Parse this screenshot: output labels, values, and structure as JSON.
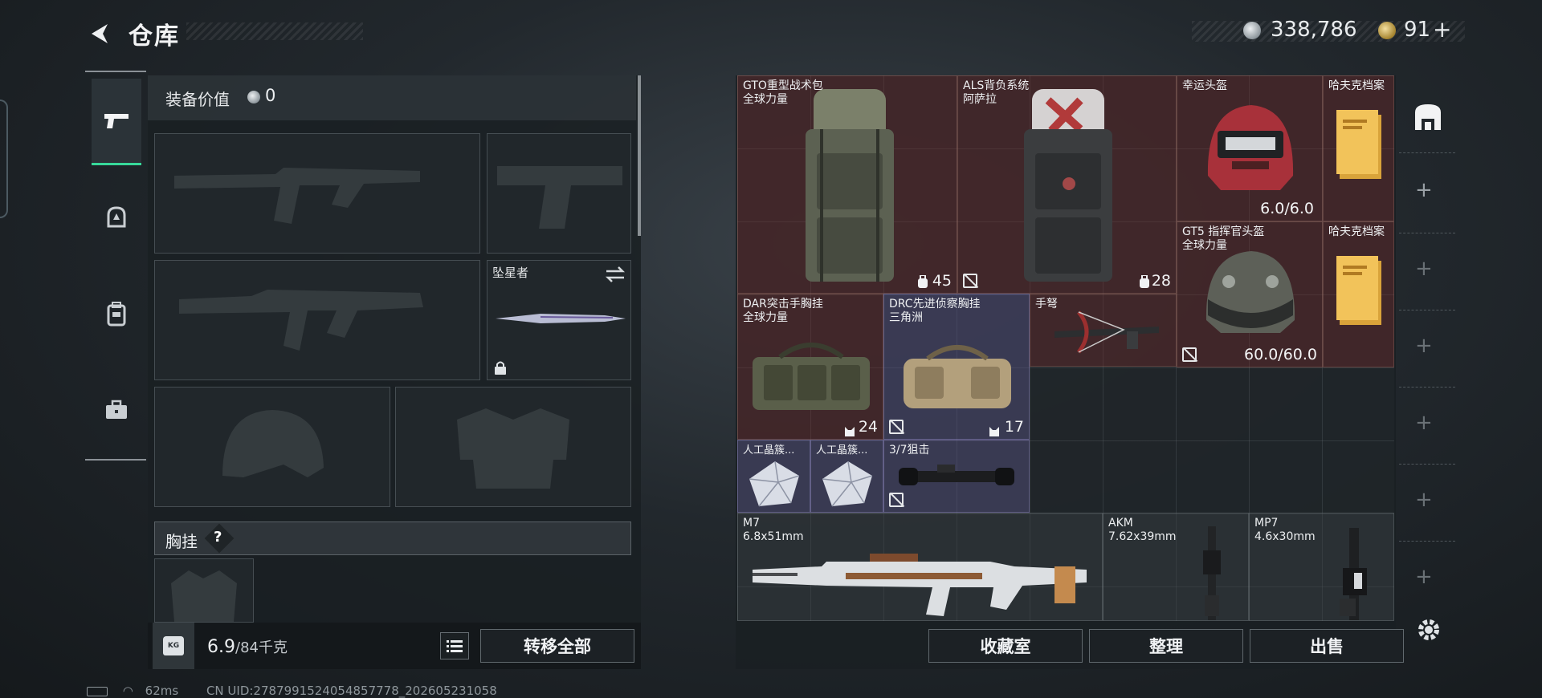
{
  "header": {
    "title": "仓库",
    "currency_silver": "338,786",
    "currency_gold": "91",
    "currency_gold_plus": "+"
  },
  "equipment": {
    "value_label": "装备价值",
    "value": "0",
    "melee_name": "坠星者",
    "chest_label": "胸挂",
    "chest_help": "?"
  },
  "weight": {
    "icon_text": "KG",
    "current": "6.9",
    "max": "/84千克"
  },
  "buttons": {
    "transfer_all": "转移全部",
    "collection_room": "收藏室",
    "sort": "整理",
    "sell": "出售"
  },
  "inventory": {
    "items": [
      {
        "name": "GTO重型战术包",
        "sub": "全球力量",
        "count": "45"
      },
      {
        "name": "ALS背负系统",
        "sub": "阿萨拉",
        "count": "28"
      },
      {
        "name": "幸运头盔",
        "durability": "6.0/6.0"
      },
      {
        "name": "哈夫克档案"
      },
      {
        "name": "GT5 指挥官头盔",
        "sub": "全球力量",
        "durability": "60.0/60.0"
      },
      {
        "name": "哈夫克档案"
      },
      {
        "name": "DAR突击手胸挂",
        "sub": "全球力量",
        "count": "24"
      },
      {
        "name": "DRC先进侦察胸挂",
        "sub": "三角洲",
        "count": "17"
      },
      {
        "name": "手弩"
      },
      {
        "name": "人工晶簇..."
      },
      {
        "name": "人工晶簇..."
      },
      {
        "name": "3/7狙击"
      },
      {
        "name": "M7",
        "sub": "6.8x51mm"
      },
      {
        "name": "AKM",
        "sub": "7.62x39mm"
      },
      {
        "name": "MP7",
        "sub": "4.6x30mm"
      }
    ]
  },
  "status_bar": {
    "ping": "62ms",
    "uid": "CN UID:2787991524054857778_202605231058"
  },
  "icons": {
    "back": "back-arrow-icon",
    "pistol_tab": "pistol-icon",
    "helmet_tab": "helmet-icon",
    "backpack_tab": "backpack-icon",
    "toolbox_tab": "toolbox-icon",
    "settings": "gear-icon",
    "storage": "storage-icon"
  },
  "colors": {
    "accent_green": "#37d99a",
    "gold_rarity": "#762a2a",
    "purple_rarity": "#585484"
  }
}
